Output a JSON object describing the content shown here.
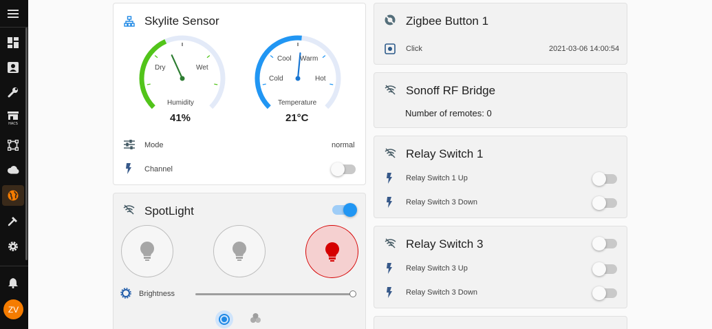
{
  "sidebar": {
    "items": [
      {
        "icon": "menu-icon"
      },
      {
        "icon": "dashboard-icon"
      },
      {
        "icon": "account-box-icon"
      },
      {
        "icon": "wrench-icon"
      },
      {
        "icon": "hacs-store-icon",
        "badge": "HACS"
      },
      {
        "icon": "vector-square-icon"
      },
      {
        "icon": "cloud-icon"
      },
      {
        "icon": "globe-icon",
        "active": true
      },
      {
        "icon": "hammer-icon"
      },
      {
        "icon": "cog-icon"
      },
      {
        "icon": "bell-icon"
      }
    ],
    "avatar_initials": "ZV",
    "active_color": "#f57c00"
  },
  "skylite": {
    "title": "Skylite Sensor",
    "humidity": {
      "label": "Humidity",
      "left_label": "Dry",
      "right_label": "Wet",
      "value": "41%",
      "level": 0.41,
      "color": "#52c41a"
    },
    "temperature": {
      "label": "Temperature",
      "labels": [
        "Cool",
        "Warm",
        "Cold",
        "Hot"
      ],
      "value": "21°C",
      "level": 0.52,
      "color": "#2196f3"
    },
    "rows": [
      {
        "label": "Mode",
        "value": "normal",
        "icon": "tune-icon"
      },
      {
        "label": "Channel",
        "icon": "flash-icon",
        "toggle": false
      }
    ]
  },
  "spotlight": {
    "title": "SpotLight",
    "toggle": true,
    "brightness_label": "Brightness",
    "brightness_level": 1.0,
    "bulbs": [
      {
        "on": false
      },
      {
        "on": false
      },
      {
        "on": true
      }
    ]
  },
  "zigbee": {
    "title": "Zigbee Button 1",
    "row_label": "Click",
    "row_value": "2021-03-06 14:00:54"
  },
  "sonoff": {
    "title": "Sonoff RF Bridge",
    "text": "Number of remotes: 0"
  },
  "relay1": {
    "title": "Relay Switch 1",
    "rows": [
      {
        "label": "Relay Switch 1 Up",
        "toggle": false
      },
      {
        "label": "Relay Switch 3 Down",
        "toggle": false
      }
    ]
  },
  "relay3": {
    "title": "Relay Switch 3",
    "toggle": false,
    "rows": [
      {
        "label": "Relay Switch 3 Up",
        "toggle": false
      },
      {
        "label": "Relay Switch 3 Down",
        "toggle": false
      }
    ]
  }
}
